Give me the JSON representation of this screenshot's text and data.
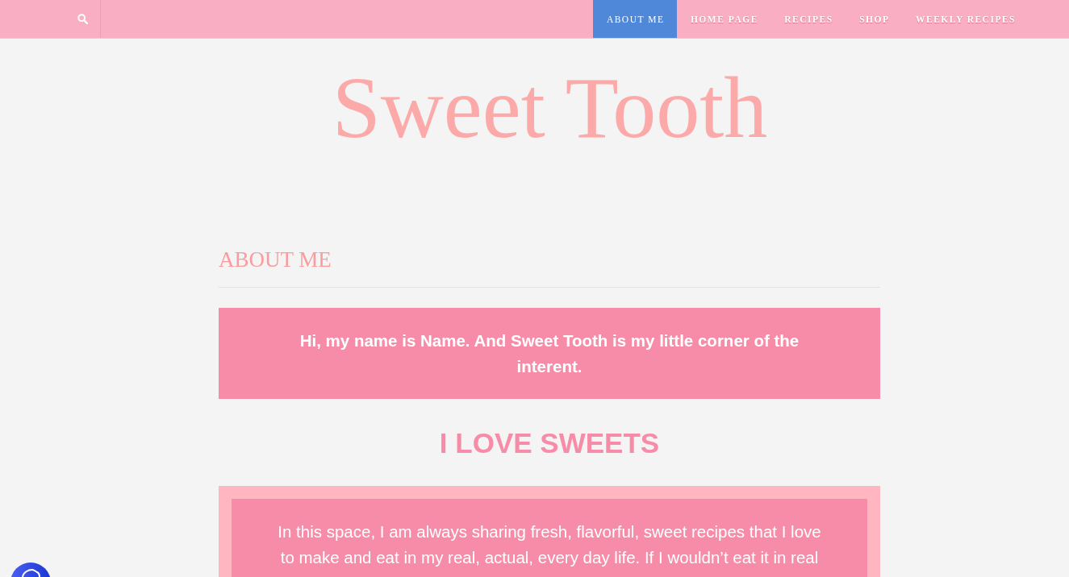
{
  "nav": {
    "items": [
      {
        "label": "ABOUT ME",
        "selected": true
      },
      {
        "label": "HOME PAGE",
        "selected": false
      },
      {
        "label": "RECIPES",
        "selected": false
      },
      {
        "label": "SHOP",
        "selected": false
      },
      {
        "label": "WEEKLY RECIPES",
        "selected": false
      }
    ]
  },
  "header": {
    "title": "Sweet Tooth"
  },
  "page": {
    "heading": "ABOUT ME",
    "intro": "Hi, my name is Name. And Sweet Tooth is my little corner of the interent.",
    "section_heading": "I LOVE SWEETS",
    "body": "In this space, I am always sharing fresh, flavorful, sweet recipes that I love to make and eat in my real, actual, every day life. If I wouldn’t eat it in real"
  }
}
